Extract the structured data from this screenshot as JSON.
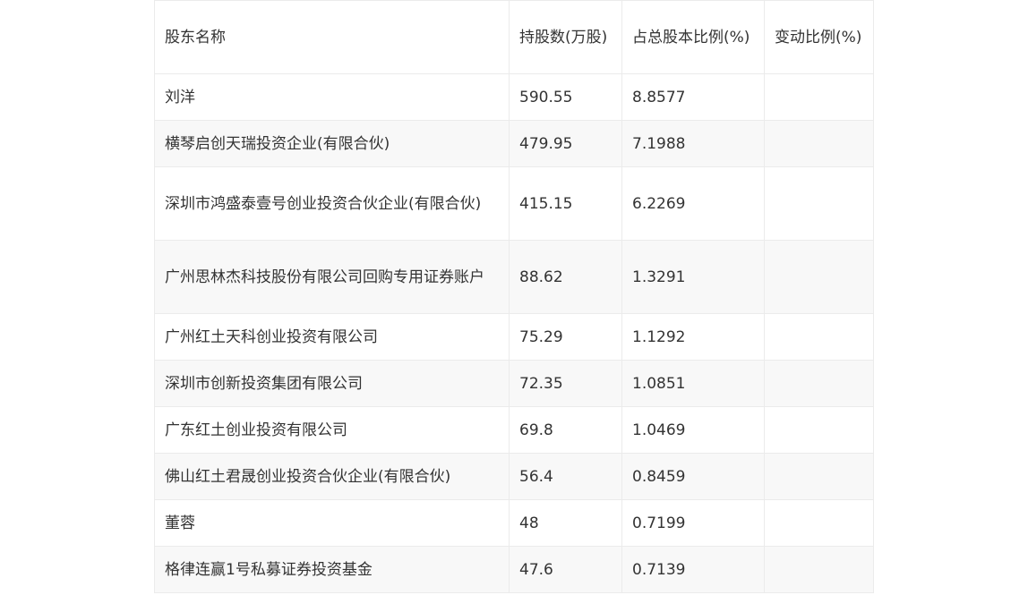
{
  "table": {
    "headers": [
      "股东名称",
      "持股数(万股)",
      "占总股本比例(%)",
      "变动比例(%)"
    ],
    "rows": [
      {
        "name": "刘洋",
        "shares": "590.55",
        "ratio": "8.8577",
        "change": ""
      },
      {
        "name": "横琴启创天瑞投资企业(有限合伙)",
        "shares": "479.95",
        "ratio": "7.1988",
        "change": ""
      },
      {
        "name": "深圳市鸿盛泰壹号创业投资合伙企业(有限合伙)",
        "shares": "415.15",
        "ratio": "6.2269",
        "change": ""
      },
      {
        "name": "广州思林杰科技股份有限公司回购专用证券账户",
        "shares": "88.62",
        "ratio": "1.3291",
        "change": ""
      },
      {
        "name": "广州红土天科创业投资有限公司",
        "shares": "75.29",
        "ratio": "1.1292",
        "change": ""
      },
      {
        "name": "深圳市创新投资集团有限公司",
        "shares": "72.35",
        "ratio": "1.0851",
        "change": ""
      },
      {
        "name": "广东红土创业投资有限公司",
        "shares": "69.8",
        "ratio": "1.0469",
        "change": ""
      },
      {
        "name": "佛山红土君晟创业投资合伙企业(有限合伙)",
        "shares": "56.4",
        "ratio": "0.8459",
        "change": ""
      },
      {
        "name": "董蓉",
        "shares": "48",
        "ratio": "0.7199",
        "change": ""
      },
      {
        "name": "格律连赢1号私募证券投资基金",
        "shares": "47.6",
        "ratio": "0.7139",
        "change": ""
      }
    ]
  }
}
